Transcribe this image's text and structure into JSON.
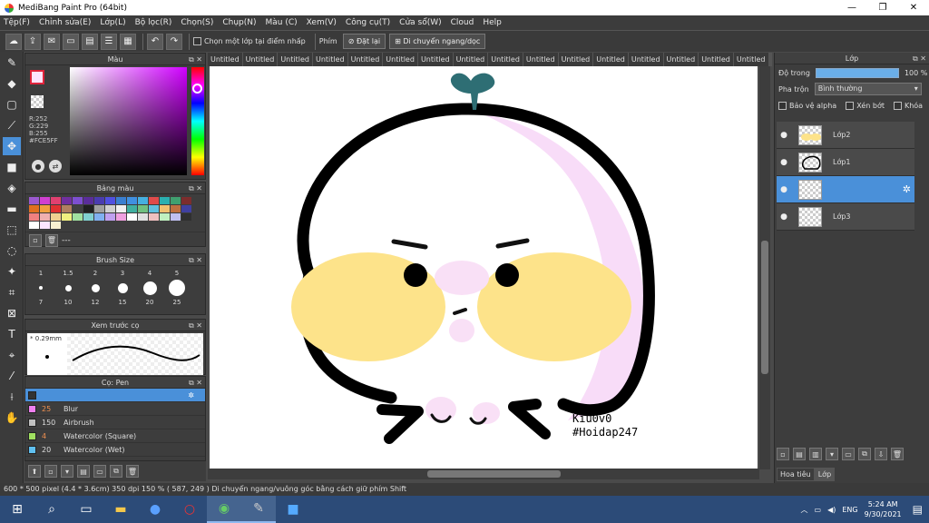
{
  "window": {
    "title": "MediBang Paint Pro (64bit)",
    "minimize": "—",
    "maximize": "❐",
    "close": "✕"
  },
  "menu": [
    "Tệp(F)",
    "Chỉnh sửa(E)",
    "Lớp(L)",
    "Bộ lọc(R)",
    "Chọn(S)",
    "Chụp(N)",
    "Màu (C)",
    "Xem(V)",
    "Công cụ(T)",
    "Cửa sổ(W)",
    "Cloud",
    "Help"
  ],
  "toolbar": {
    "checkbox_label": "Chọn một lớp tại điểm nhấp",
    "key_label": "Phím",
    "reset_label": "Đặt lại",
    "move_label": "Di chuyển ngang/dọc"
  },
  "color_panel": {
    "title": "Màu",
    "r": "R:252",
    "g": "G:229",
    "b": "B:255",
    "hex": "#FCE5FF",
    "fg_color": "#fce5ff",
    "bg_color": "#c060e0",
    "fg_border": "#e0243b"
  },
  "palette_panel": {
    "title": "Bảng màu",
    "colors": [
      "#9b59d0",
      "#d040d0",
      "#e04070",
      "#7030a0",
      "#7d4fd0",
      "#5a2d9a",
      "#4a3cb0",
      "#5050e0",
      "#3a7fd0",
      "#4090e0",
      "#46b0e0",
      "#e04b4b",
      "#2ab0b0",
      "#40a070",
      "#7d2d2d",
      "#e07020",
      "#f0a040",
      "#e03030",
      "#b08060",
      "#404040",
      "#202020",
      "#a0a0a0",
      "#d0d0d0",
      "#f0f0f0",
      "#40b0a0",
      "#70c080",
      "#60c0e0",
      "#f0c070",
      "#c07040",
      "#4040a0",
      "#f08080",
      "#f0b0b0",
      "#f0d090",
      "#f0f080",
      "#a0e0a0",
      "#80d0d0",
      "#80b0f0",
      "#c0a0f0",
      "#f0a0e0",
      "#ffffff",
      "#e0e0e0",
      "#f0c0c0",
      "#c0f0c0",
      "#c0c0f0",
      "#303030",
      "#ffffff",
      "#fce5ff",
      "#f8f0d0"
    ],
    "selected_text": "---"
  },
  "brush_size_panel": {
    "title": "Brush Size",
    "sizes_top": [
      "1",
      "1.5",
      "2",
      "3",
      "4",
      "5"
    ],
    "sizes_bottom": [
      "7",
      "10",
      "12",
      "15",
      "20",
      "25"
    ]
  },
  "brush_preview_panel": {
    "title": "Xem trước cọ",
    "size": "0.29mm"
  },
  "brush_panel": {
    "title": "Cọ: Pen",
    "items": [
      {
        "num": "25",
        "name": "Blur",
        "color": "#f080f0",
        "num_color": "#f09050"
      },
      {
        "num": "150",
        "name": "Airbrush",
        "color": "#c0c0c0",
        "num_color": "#dddddd"
      },
      {
        "num": "4",
        "name": "Watercolor (Square)",
        "color": "#a0e060",
        "num_color": "#f09050"
      },
      {
        "num": "20",
        "name": "Watercolor (Wet)",
        "color": "#60c0f0",
        "num_color": "#dddddd"
      }
    ]
  },
  "tabs": [
    "Untitled",
    "Untitled",
    "Untitled",
    "Untitled",
    "Untitled",
    "Untitled",
    "Untitled",
    "Untitled",
    "Untitled",
    "Untitled",
    "Untitled",
    "Untitled",
    "Untitled",
    "Untitled",
    "Untitled",
    "Untitled",
    "Untitled"
  ],
  "canvas": {
    "signature_line1": "Kiu0v0",
    "signature_line2": "#Hoidap247"
  },
  "layer_panel": {
    "title": "Lớp",
    "opacity_label": "Độ trong",
    "opacity_value": "100 %",
    "blend_label": "Pha trộn",
    "blend_value": "Bình thường",
    "alpha_label": "Bảo vệ alpha",
    "clip_label": "Xén bớt",
    "lock_label": "Khóa",
    "layers": [
      {
        "name": "Lớp2"
      },
      {
        "name": "Lớp1"
      },
      {
        "name": ""
      },
      {
        "name": "Lớp3"
      }
    ],
    "tab_navigator": "Hoa tiêu",
    "tab_layer": "Lớp"
  },
  "status": "600 * 500 pixel  (4.4 * 3.6cm)  350 dpi  150 %  ( 587, 249 )  Di chuyển ngang/vuông góc bằng cách giữ phím Shift",
  "taskbar": {
    "language": "ENG",
    "time": "5:24 AM",
    "date": "9/30/2021"
  }
}
